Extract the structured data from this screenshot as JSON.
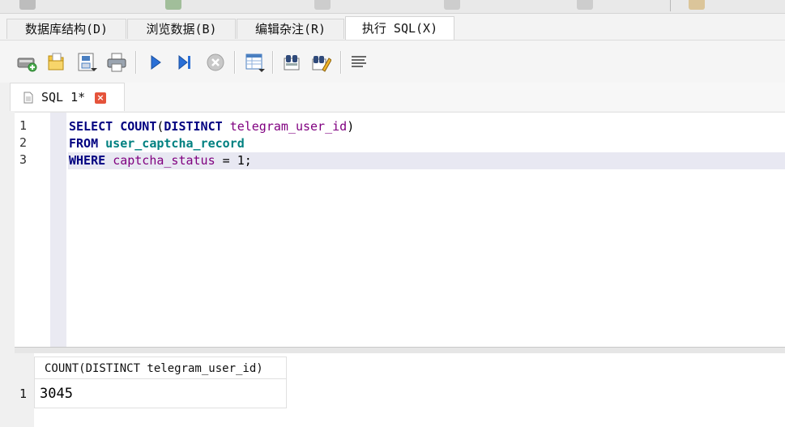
{
  "main_tabs": [
    {
      "label": "数据库结构(D)",
      "active": false
    },
    {
      "label": "浏览数据(B)",
      "active": false
    },
    {
      "label": "编辑杂注(R)",
      "active": false
    },
    {
      "label": "执行 SQL(X)",
      "active": true
    }
  ],
  "toolbar": {
    "icons": [
      "open-tab-icon",
      "open-file-icon",
      "save-file-icon",
      "print-icon",
      "execute-all-icon",
      "execute-line-icon",
      "stop-icon",
      "save-results-icon",
      "find-icon",
      "find-replace-icon",
      "comment-icon"
    ]
  },
  "editor_tab": {
    "label": "SQL 1*"
  },
  "editor": {
    "line_numbers": [
      "1",
      "2",
      "3"
    ],
    "lines": [
      {
        "t1": "SELECT",
        "t2": " ",
        "t3": "COUNT",
        "t4": "(",
        "t5": "DISTINCT",
        "t6": " ",
        "t7": "telegram_user_id",
        "t8": ")"
      },
      {
        "t1": "FROM",
        "t2": " ",
        "t3": "user_captcha_record"
      },
      {
        "t1": "WHERE",
        "t2": " ",
        "t3": "captcha_status",
        "t4": " = 1;"
      }
    ]
  },
  "results": {
    "columns": [
      "COUNT(DISTINCT telegram_user_id)"
    ],
    "rows": [
      {
        "num": "1",
        "cells": [
          "3045"
        ]
      }
    ]
  },
  "colors": {
    "keyword": "#000080",
    "identifier": "#800080",
    "table": "#008080",
    "current_line": "#e8e8f2"
  }
}
